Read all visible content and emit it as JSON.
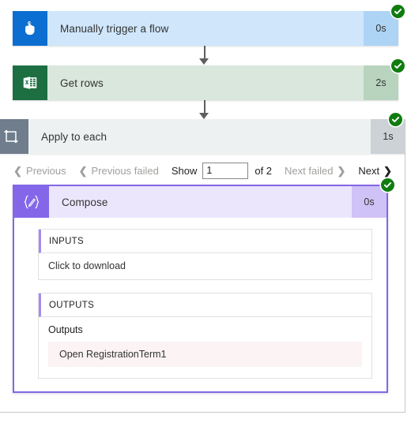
{
  "flow": {
    "steps": [
      {
        "id": "trigger",
        "title": "Manually trigger a flow",
        "duration": "0s",
        "status": "succeeded",
        "icon": "tap-hand-icon",
        "icon_bg": "#0b6ed0",
        "body_bg": "#cfe6fb",
        "duration_bg": "#aed4f5"
      },
      {
        "id": "getrows",
        "title": "Get rows",
        "duration": "2s",
        "status": "succeeded",
        "icon": "excel-icon",
        "icon_bg": "#1d6f42",
        "body_bg": "#d9e7dc",
        "duration_bg": "#b8d3be"
      },
      {
        "id": "applytoeach",
        "title": "Apply to each",
        "duration": "1s",
        "status": "succeeded",
        "icon": "foreach-loop-icon",
        "icon_bg": "#6f7d8c",
        "body_bg": "#eef1f2",
        "duration_bg": "#ccd2d6"
      },
      {
        "id": "compose",
        "title": "Compose",
        "duration": "0s",
        "status": "succeeded",
        "icon": "compose-braces-icon",
        "icon_bg": "#8367e8",
        "body_bg": "#ece6fd",
        "duration_bg": "#cfc2f7"
      }
    ]
  },
  "pagination": {
    "previous_label": "Previous",
    "previous_failed_label": "Previous failed",
    "show_label": "Show",
    "page_value": "1",
    "page_placeholder": "",
    "of_label": "of 2",
    "total_pages": 2,
    "next_failed_label": "Next failed",
    "next_label": "Next",
    "previous_enabled": false,
    "previous_failed_enabled": false,
    "next_failed_enabled": false,
    "next_enabled": true
  },
  "compose": {
    "inputs": {
      "header": "INPUTS",
      "content": "Click to download"
    },
    "outputs": {
      "header": "OUTPUTS",
      "label": "Outputs",
      "value": "Open RegistrationTerm1"
    }
  },
  "colors": {
    "success_green": "#107c10",
    "compose_accent": "#8367e8",
    "io_accent": "#a48cf0",
    "output_value_bg": "#fbf3f4",
    "connector": "#605e5c",
    "disabled_text": "#a19f9d",
    "text": "#201f1e"
  }
}
